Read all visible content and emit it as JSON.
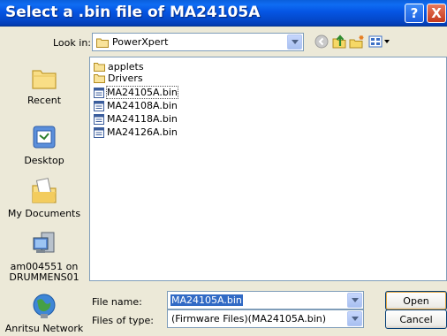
{
  "window": {
    "title": "Select a .bin file of MA24105A",
    "help_label": "?",
    "close_label": "X"
  },
  "lookin": {
    "label": "Look in:",
    "value": "PowerXpert"
  },
  "toolbar": {
    "icons": [
      "back-icon",
      "up-folder-icon",
      "new-folder-icon",
      "view-menu-icon"
    ]
  },
  "places": [
    {
      "label": "Recent",
      "icon": "recent-folder-icon"
    },
    {
      "label": "Desktop",
      "icon": "desktop-icon"
    },
    {
      "label": "My Documents",
      "icon": "my-documents-icon"
    },
    {
      "label": "am004551 on DRUMMENS01",
      "icon": "my-computer-icon"
    },
    {
      "label": "Anritsu Network",
      "icon": "network-icon"
    }
  ],
  "files": [
    {
      "name": "applets",
      "type": "folder"
    },
    {
      "name": "Drivers",
      "type": "folder"
    },
    {
      "name": "MA24105A.bin",
      "type": "file",
      "selected": true
    },
    {
      "name": "MA24108A.bin",
      "type": "file"
    },
    {
      "name": "MA24118A.bin",
      "type": "file"
    },
    {
      "name": "MA24126A.bin",
      "type": "file"
    }
  ],
  "form": {
    "filename_label": "File name:",
    "filename_value": "MA24105A.bin",
    "filetype_label": "Files of type:",
    "filetype_value": "(Firmware Files)(MA24105A.bin)",
    "open_label": "Open",
    "cancel_label": "Cancel"
  },
  "colors": {
    "titlebar": "#0556E4",
    "selection": "#316AC5",
    "dialog_bg": "#ECE9D8"
  }
}
